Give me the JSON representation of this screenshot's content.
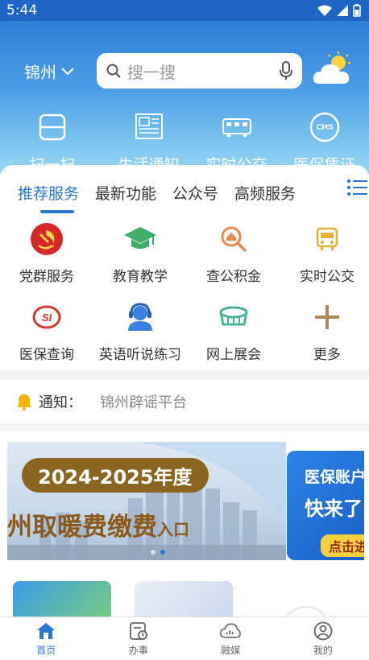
{
  "status_bar": {
    "time": "5:44"
  },
  "header": {
    "city": "锦州",
    "search_placeholder": "搜一搜"
  },
  "quick_actions": [
    {
      "label": "扫一扫",
      "icon": "scan-icon"
    },
    {
      "label": "生活通知",
      "icon": "news-icon"
    },
    {
      "label": "实时公交",
      "icon": "bus-icon"
    },
    {
      "label": "医保凭证",
      "icon": "chs-icon"
    }
  ],
  "tabs": [
    "推荐服务",
    "最新功能",
    "公众号",
    "高频服务"
  ],
  "services": [
    {
      "label": "党群服务",
      "icon": "party-emblem-icon"
    },
    {
      "label": "教育教学",
      "icon": "graduation-cap-icon"
    },
    {
      "label": "查公积金",
      "icon": "housing-fund-search-icon"
    },
    {
      "label": "实时公交",
      "icon": "bus-icon"
    },
    {
      "label": "医保查询",
      "icon": "social-insurance-icon"
    },
    {
      "label": "英语听说练习",
      "icon": "headset-user-icon"
    },
    {
      "label": "网上展会",
      "icon": "exhibition-icon"
    },
    {
      "label": "更多",
      "icon": "plus-icon"
    }
  ],
  "notice": {
    "label": "通知：",
    "text": "锦州辟谣平台"
  },
  "banner": {
    "pill": "2024-2025年度",
    "title_prefix": "州",
    "title_main": "取暖费缴费",
    "title_suffix": "入口",
    "side_line1": "医保账户",
    "side_line2": "快来了",
    "side_button": "点击进"
  },
  "bottom_nav": [
    {
      "label": "首页",
      "icon": "home-icon",
      "active": true
    },
    {
      "label": "办事",
      "icon": "tasks-icon",
      "active": false
    },
    {
      "label": "融媒",
      "icon": "media-cloud-icon",
      "active": false
    },
    {
      "label": "我的",
      "icon": "profile-icon",
      "active": false
    }
  ],
  "colors": {
    "primary": "#2a78cf",
    "header_top": "#2f7fd8",
    "party_red": "#d7282a",
    "edu_green": "#3fae6a",
    "fund_orange": "#e98a52",
    "bus_yellow": "#e6b13a",
    "insurance_red": "#d43b2f",
    "exhibition_teal": "#49b39b",
    "more_brown": "#b08a5a"
  }
}
